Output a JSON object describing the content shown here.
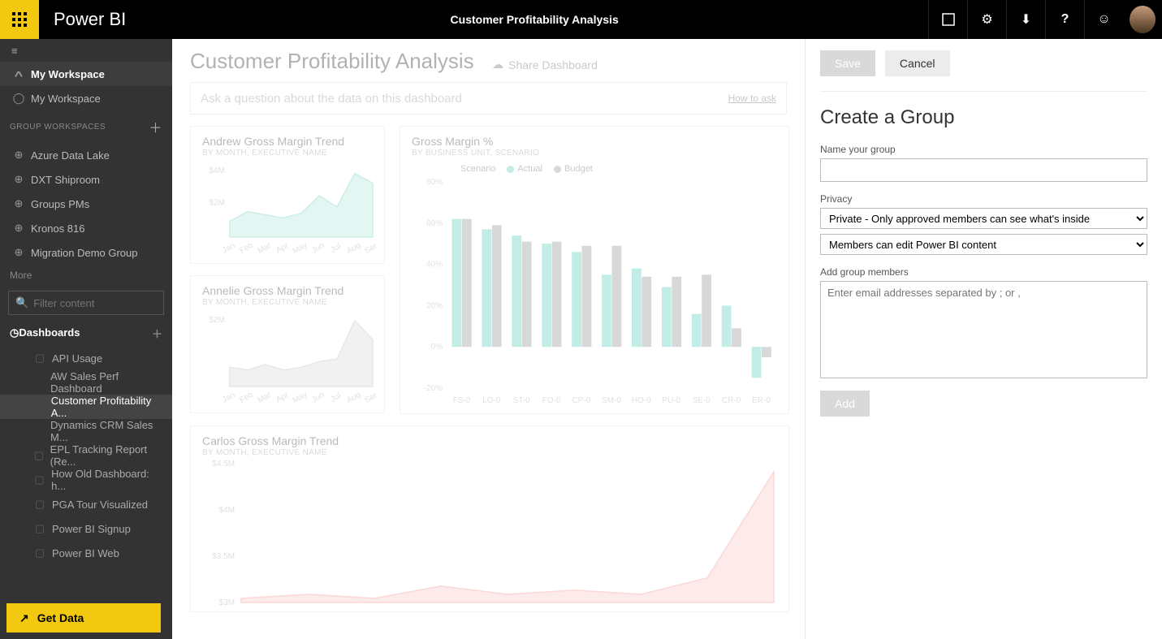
{
  "topbar": {
    "brand": "Power BI",
    "page_title": "Customer Profitability Analysis"
  },
  "sidebar": {
    "my_workspace_top": "My Workspace",
    "my_workspace_sub": "My Workspace",
    "group_header": "GROUP WORKSPACES",
    "groups": [
      "Azure Data Lake",
      "DXT Shiproom",
      "Groups PMs",
      "Kronos 816",
      "Migration Demo Group"
    ],
    "more": "More",
    "filter_placeholder": "Filter content",
    "dash_header": "Dashboards",
    "dashboards": [
      "API Usage",
      "AW Sales Perf Dashboard",
      "Customer Profitability A...",
      "Dynamics CRM Sales M...",
      "EPL Tracking Report (Re...",
      "How Old Dashboard: h...",
      "PGA Tour Visualized",
      "Power BI Signup",
      "Power BI Web"
    ],
    "active_dash_index": 2,
    "get_data": "Get Data"
  },
  "dashboard": {
    "title": "Customer Profitability Analysis",
    "share": "Share Dashboard",
    "qa_placeholder": "Ask a question about the data on this dashboard",
    "howto": "How to ask",
    "tiles": {
      "andrew": {
        "title": "Andrew Gross Margin Trend",
        "sub": "BY MONTH, EXECUTIVE NAME"
      },
      "annelie": {
        "title": "Annelie Gross Margin Trend",
        "sub": "BY MONTH, EXECUTIVE NAME"
      },
      "gm": {
        "title": "Gross Margin %",
        "sub": "BY BUSINESS UNIT, SCENARIO",
        "legend_label": "Scenario",
        "legend": [
          "Actual",
          "Budget"
        ]
      },
      "carlos": {
        "title": "Carlos Gross Margin Trend",
        "sub": "BY MONTH, EXECUTIVE NAME"
      }
    }
  },
  "chart_data": [
    {
      "id": "andrew",
      "type": "area",
      "categories": [
        "Jan",
        "Feb",
        "Mar",
        "Apr",
        "May",
        "Jun",
        "Jul",
        "Aug",
        "Sep"
      ],
      "values": [
        1.0,
        1.6,
        1.4,
        1.2,
        1.5,
        2.6,
        1.9,
        4.0,
        3.4
      ],
      "yticks": [
        "$2M",
        "$4M"
      ],
      "ylim": [
        0,
        4.5
      ],
      "color": "#8fd9cc"
    },
    {
      "id": "annelie",
      "type": "area",
      "categories": [
        "Jan",
        "Feb",
        "Mar",
        "Apr",
        "May",
        "Jun",
        "Jul",
        "Aug",
        "Sep"
      ],
      "values": [
        0.7,
        0.6,
        0.8,
        0.6,
        0.7,
        0.9,
        1.0,
        2.4,
        1.7
      ],
      "yticks": [
        "$2M"
      ],
      "ylim": [
        0,
        2.6
      ],
      "color": "#c9c9c9"
    },
    {
      "id": "gm",
      "type": "bar",
      "categories": [
        "FS-0",
        "LO-0",
        "ST-0",
        "FO-0",
        "CP-0",
        "SM-0",
        "HO-0",
        "PU-0",
        "SE-0",
        "CR-0",
        "ER-0"
      ],
      "series": [
        {
          "name": "Actual",
          "color": "#79d8c8",
          "values": [
            62,
            57,
            54,
            50,
            46,
            35,
            38,
            29,
            16,
            20,
            -15
          ]
        },
        {
          "name": "Budget",
          "color": "#a8a8a8",
          "values": [
            62,
            59,
            51,
            51,
            49,
            49,
            34,
            34,
            35,
            9,
            -5
          ]
        }
      ],
      "yticks": [
        "-20%",
        "0%",
        "20%",
        "40%",
        "60%",
        "80%"
      ],
      "ylim": [
        -20,
        80
      ]
    },
    {
      "id": "carlos",
      "type": "area",
      "categories": [
        "$3M",
        "$3.5M",
        "$4M",
        "$4.5M"
      ],
      "yticks": [
        "$3M",
        "$3.5M",
        "$4M",
        "$4.5M"
      ],
      "ylim": [
        3,
        4.7
      ],
      "color": "#f7a6a6",
      "values": [
        3.05,
        3.1,
        3.05,
        3.2,
        3.1,
        3.15,
        3.1,
        3.3,
        4.6
      ]
    }
  ],
  "panel": {
    "save": "Save",
    "cancel": "Cancel",
    "heading": "Create a Group",
    "name_label": "Name your group",
    "privacy_label": "Privacy",
    "privacy_value": "Private - Only approved members can see what's inside",
    "perm_value": "Members can edit Power BI content",
    "members_label": "Add group members",
    "members_placeholder": "Enter email addresses separated by ; or ,",
    "add": "Add"
  }
}
